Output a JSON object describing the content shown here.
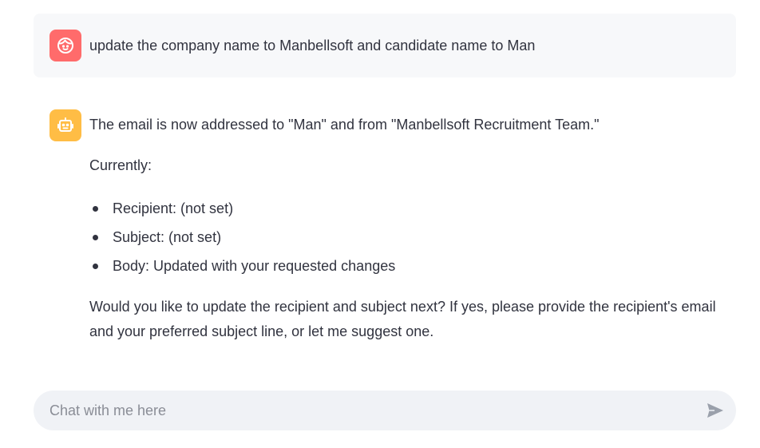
{
  "conversation": {
    "user_message": {
      "avatar_icon": "user-face-icon",
      "avatar_color": "#ff6b6b",
      "text": "update the company name to Manbellsoft and candidate name to Man"
    },
    "assistant_message": {
      "avatar_icon": "robot-icon",
      "avatar_color": "#ffbd45",
      "intro": "The email is now addressed to \"Man\" and from \"Manbellsoft Recruitment Team.\"",
      "currently_label": "Currently:",
      "bullets": [
        "Recipient: (not set)",
        "Subject: (not set)",
        "Body: Updated with your requested changes"
      ],
      "closing": "Would you like to update the recipient and subject next? If yes, please provide the recipient's email and your preferred subject line, or let me suggest one."
    }
  },
  "chat_input": {
    "value": "",
    "placeholder": "Chat with me here",
    "send_icon": "send-icon"
  }
}
